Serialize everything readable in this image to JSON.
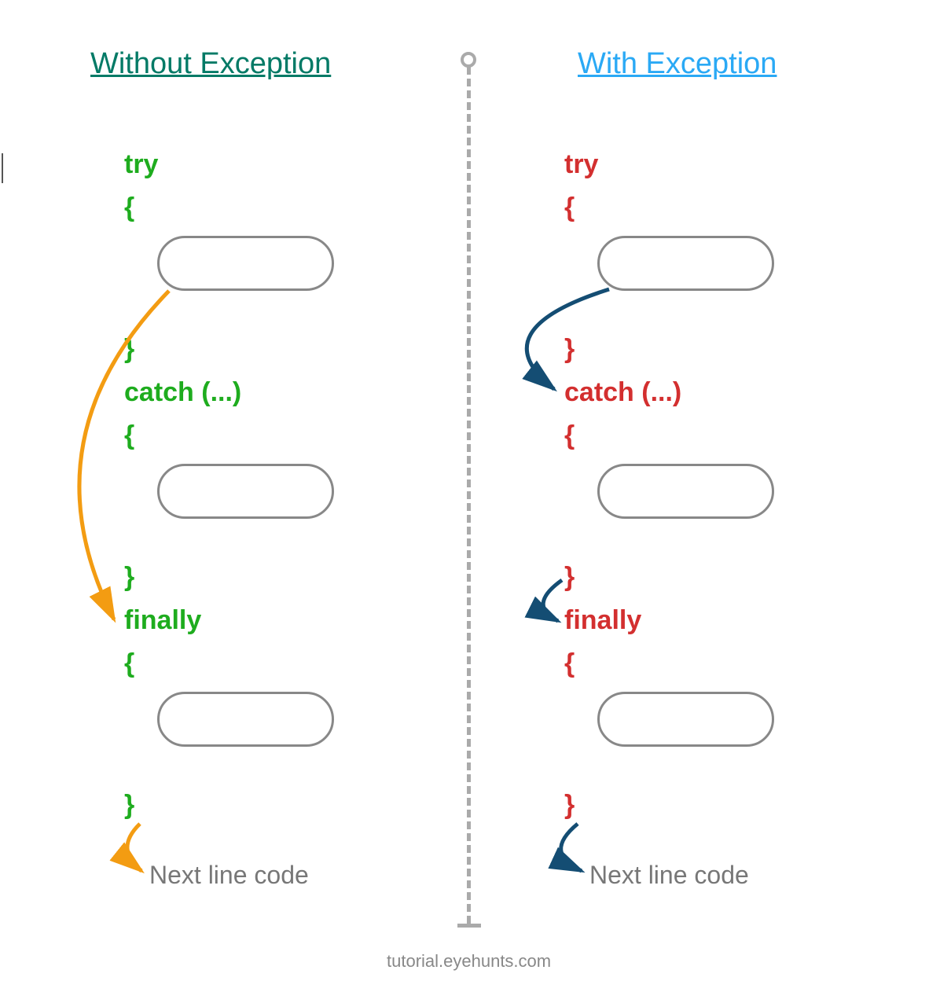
{
  "headings": {
    "without_exception": "Without Exception",
    "with_exception": "With Exception"
  },
  "keywords": {
    "try": "try",
    "open_brace": "{",
    "close_brace": "}",
    "catch": "catch (...)",
    "finally": "finally"
  },
  "next_line": "Next line code",
  "footer": "tutorial.eyehunts.com",
  "colors": {
    "left_heading": "#037a66",
    "right_heading": "#2aa9f5",
    "left_keyword": "#1eac1e",
    "right_keyword": "#d32f2f",
    "left_arrow": "#f39c12",
    "right_arrow": "#144d73",
    "divider": "#aaaaaa",
    "sub_text": "#777777"
  }
}
